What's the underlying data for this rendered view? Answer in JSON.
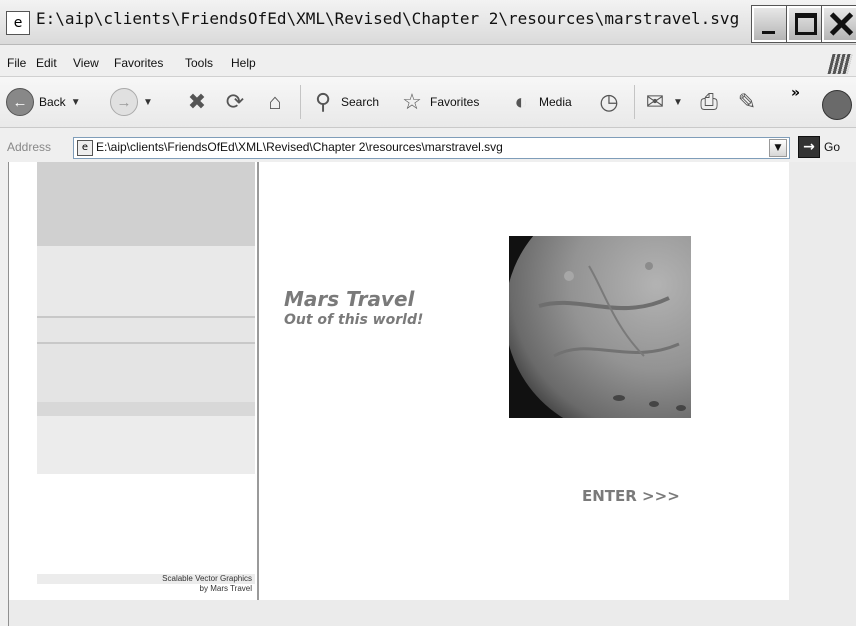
{
  "window": {
    "title": "E:\\aip\\clients\\FriendsOfEd\\XML\\Revised\\Chapter 2\\resources\\marstravel.svg - Microso..."
  },
  "menu": {
    "items": [
      "File",
      "Edit",
      "View",
      "Favorites",
      "Tools",
      "Help"
    ]
  },
  "toolbar": {
    "back": "Back",
    "search": "Search",
    "favorites": "Favorites",
    "media": "Media",
    "more": "»"
  },
  "address": {
    "label": "Address",
    "value": "E:\\aip\\clients\\FriendsOfEd\\XML\\Revised\\Chapter 2\\resources\\marstravel.svg",
    "go": "Go"
  },
  "page": {
    "title": "Mars Travel",
    "subtitle": "Out of this world!",
    "enter": "ENTER >>>",
    "credit_line1": "Scalable Vector Graphics",
    "credit_line2": "by Mars Travel"
  }
}
